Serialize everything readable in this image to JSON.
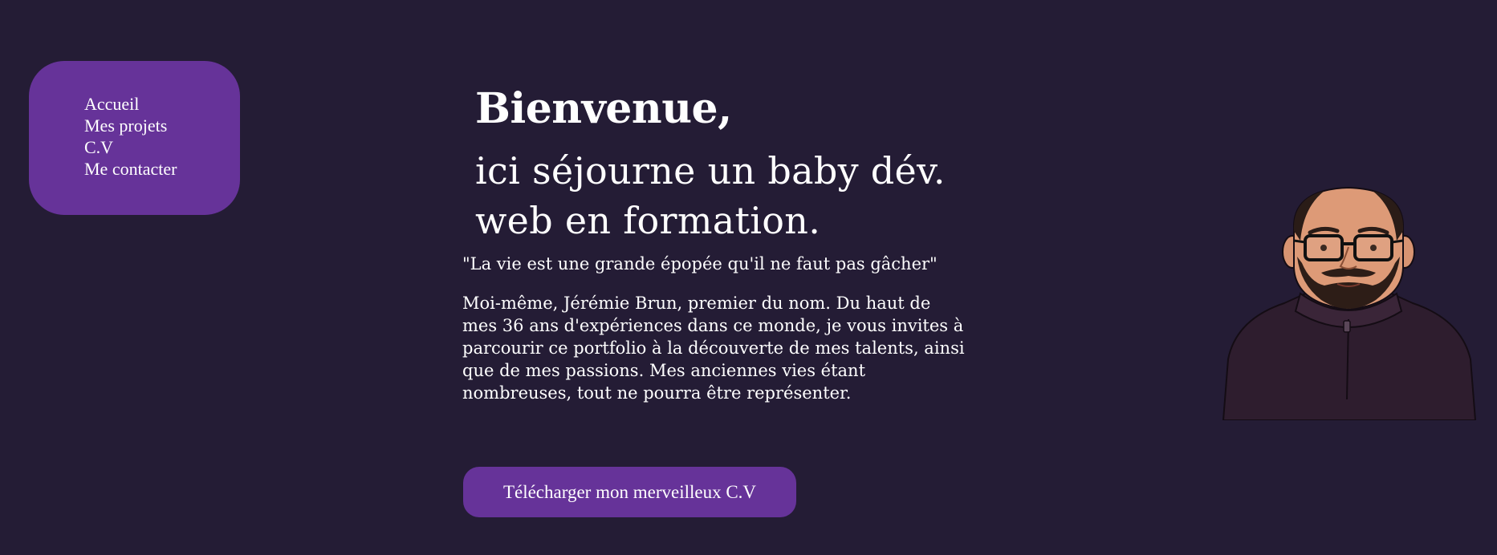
{
  "nav": {
    "items": [
      {
        "label": "Accueil"
      },
      {
        "label": "Mes projets"
      },
      {
        "label": "C.V"
      },
      {
        "label": "Me contacter"
      }
    ]
  },
  "hero": {
    "title": "Bienvenue,",
    "subtitle_line1": "ici séjourne un baby dév.",
    "subtitle_line2": "web en formation.",
    "quote": "\"La vie est une grande épopée qu'il ne faut pas gâcher\"",
    "intro": "Moi-même, Jérémie Brun, premier du nom. Du haut de mes 36 ans d'expériences dans ce monde, je vous invites à parcourir ce portfolio à la découverte de mes talents, ainsi que de mes passions. Mes anciennes vies étant nombreuses, tout ne pourra être représenter.",
    "button_label": "Télécharger mon merveilleux C.V"
  },
  "colors": {
    "background": "#241c35",
    "accent": "#663399",
    "text": "#ffffff"
  },
  "avatar": {
    "icon": "cartoon-portrait"
  }
}
